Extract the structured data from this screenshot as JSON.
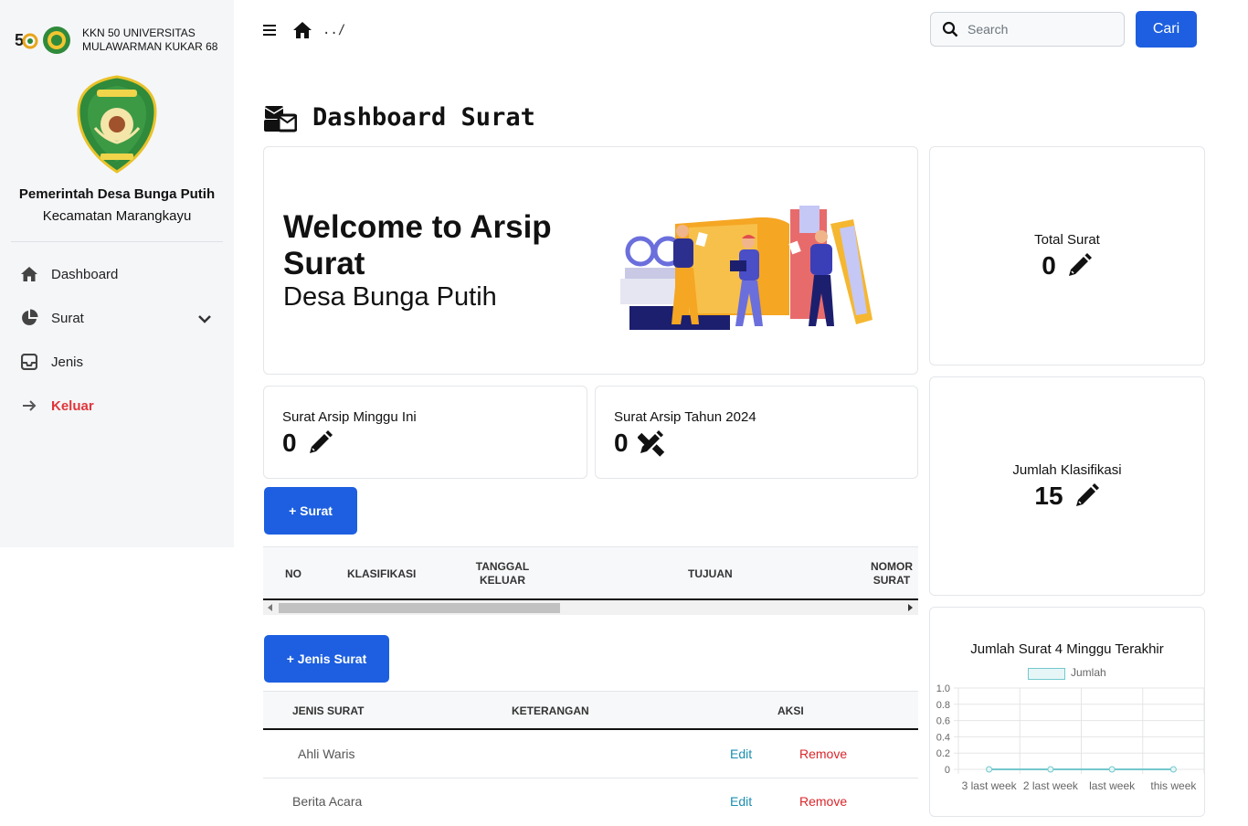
{
  "sidebar": {
    "brand_line1": "KKN 50 UNIVERSITAS",
    "brand_line2": "MULAWARMAN KUKAR 68",
    "org_title": "Pemerintah Desa Bunga Putih",
    "org_subtitle": "Kecamatan Marangkayu",
    "items": [
      {
        "label": "Dashboard",
        "icon": "home-icon"
      },
      {
        "label": "Surat",
        "icon": "pie-chart-icon"
      },
      {
        "label": "Jenis",
        "icon": "inbox-icon"
      },
      {
        "label": "Keluar",
        "icon": "arrow-right-icon"
      }
    ]
  },
  "topbar": {
    "breadcrumb": "../",
    "search_placeholder": "Search",
    "search_button": "Cari"
  },
  "page": {
    "title": "Dashboard Surat"
  },
  "welcome": {
    "title": "Welcome to Arsip Surat",
    "subtitle": "Desa Bunga Putih"
  },
  "stats": {
    "minggu_label": "Surat Arsip Minggu Ini",
    "minggu_value": "0",
    "tahun_label": "Surat Arsip Tahun 2024",
    "tahun_value": "0",
    "total_label": "Total Surat",
    "total_value": "0",
    "klasifikasi_label": "Jumlah Klasifikasi",
    "klasifikasi_value": "15"
  },
  "surat_table": {
    "add_button": "+ Surat",
    "headers": [
      "NO",
      "KLASIFIKASI",
      "TANGGAL KELUAR",
      "TUJUAN",
      "NOMOR SURAT"
    ]
  },
  "jenis_table": {
    "add_button": "+ Jenis Surat",
    "headers": [
      "JENIS SURAT",
      "KETERANGAN",
      "AKSI"
    ],
    "rows": [
      {
        "jenis": "Ahli Waris",
        "keterangan": "",
        "edit": "Edit",
        "remove": "Remove"
      },
      {
        "jenis": "Berita Acara",
        "keterangan": "",
        "edit": "Edit",
        "remove": "Remove"
      }
    ]
  },
  "chart_data": {
    "type": "line",
    "title": "Jumlah Surat 4 Minggu Terakhir",
    "categories": [
      "3 last week",
      "2 last week",
      "last week",
      "this week"
    ],
    "series": [
      {
        "name": "Jumlah",
        "values": [
          0,
          0,
          0,
          0
        ]
      }
    ],
    "ylim": [
      0,
      1.0
    ],
    "yticks": [
      "1.0",
      "0.8",
      "0.6",
      "0.4",
      "0.2",
      "0"
    ],
    "grid": true,
    "legend": "top",
    "colors": {
      "line": "#74c8cc",
      "fill": "#e6f6f7"
    }
  }
}
